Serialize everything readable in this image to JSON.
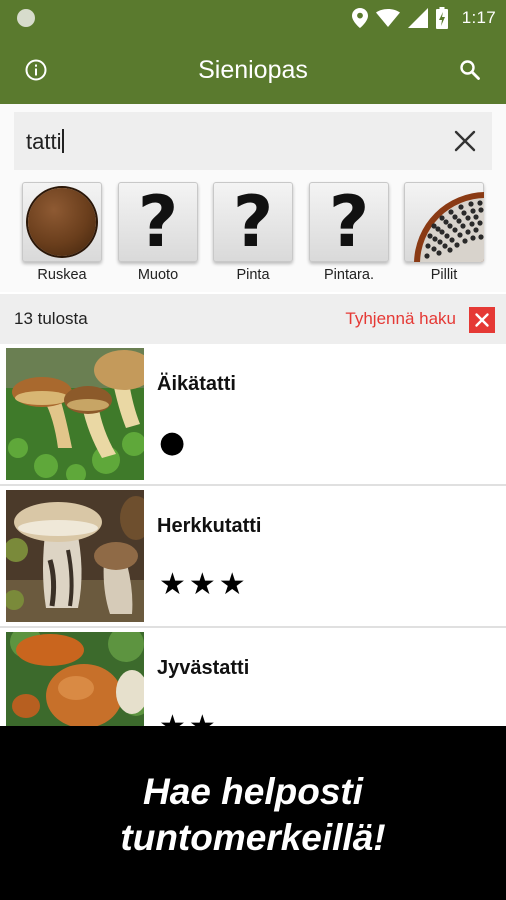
{
  "status_bar": {
    "time": "1:17"
  },
  "app_bar": {
    "title": "Sieniopas"
  },
  "search": {
    "query": "tatti"
  },
  "filters": [
    {
      "label": "Ruskea",
      "icon": "brown-color-icon"
    },
    {
      "label": "Muoto",
      "icon": "question-mark-icon"
    },
    {
      "label": "Pinta",
      "icon": "question-mark-icon"
    },
    {
      "label": "Pintara.",
      "icon": "question-mark-icon"
    },
    {
      "label": "Pillit",
      "icon": "pores-icon"
    }
  ],
  "results": {
    "count_text": "13 tulosta",
    "clear_label": "Tyhjennä haku"
  },
  "mushrooms": [
    {
      "name": "Äikätatti",
      "rating_text": "●"
    },
    {
      "name": "Herkkutatti",
      "rating_text": "★★★"
    },
    {
      "name": "Jyvästatti",
      "rating_text": "★★"
    }
  ],
  "promo": {
    "line1": "Hae helposti",
    "line2": "tuntomerkeillä!"
  },
  "colors": {
    "brand": "#5a7a2e",
    "accent_red": "#e53935"
  }
}
